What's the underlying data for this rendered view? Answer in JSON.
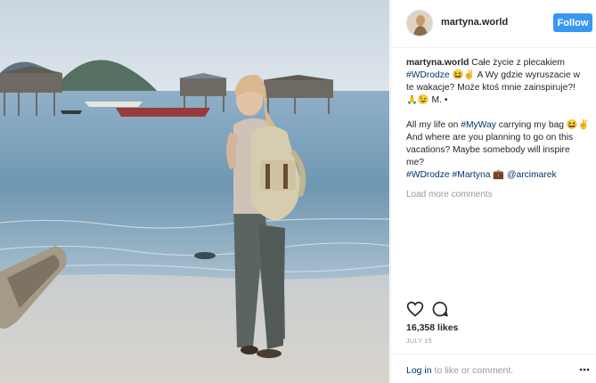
{
  "post": {
    "username": "martyna.world",
    "follow_label": "Follow",
    "caption": {
      "username": "martyna.world",
      "text_pl_1": " Całe życie z plecakiem ",
      "tag_wdrodze": "#WDrodze",
      "text_pl_2": " A Wy gdzie wyruszacie w te wakacje? Może ktoś mnie zainspiruje?! ",
      "text_pl_3": " M. •",
      "text_en_1": "All my life on ",
      "tag_myway": "#MyWay",
      "text_en_2": " carrying my bag ",
      "text_en_3": " And where are you planning to go on this vacations? Maybe somebody will inspire me?",
      "tag_wdrodze2": "#WDrodze",
      "tag_martyna": "#Martyna",
      "mention": "@arcimarek",
      "emoji_1": "😆✌",
      "emoji_2": "🙏😉",
      "emoji_3": "😆✌",
      "emoji_4": "💼"
    },
    "load_more": "Load more comments",
    "likes": "16,358 likes",
    "date": "JULY 15",
    "footer": {
      "login": "Log in",
      "rest": " to like or comment."
    }
  },
  "icons": {
    "like": "heart-outline-icon",
    "comment": "speech-bubble-icon",
    "more": "ellipsis-icon"
  },
  "colors": {
    "follow_button": "#3897f0",
    "link": "#003569",
    "muted": "#999999"
  }
}
